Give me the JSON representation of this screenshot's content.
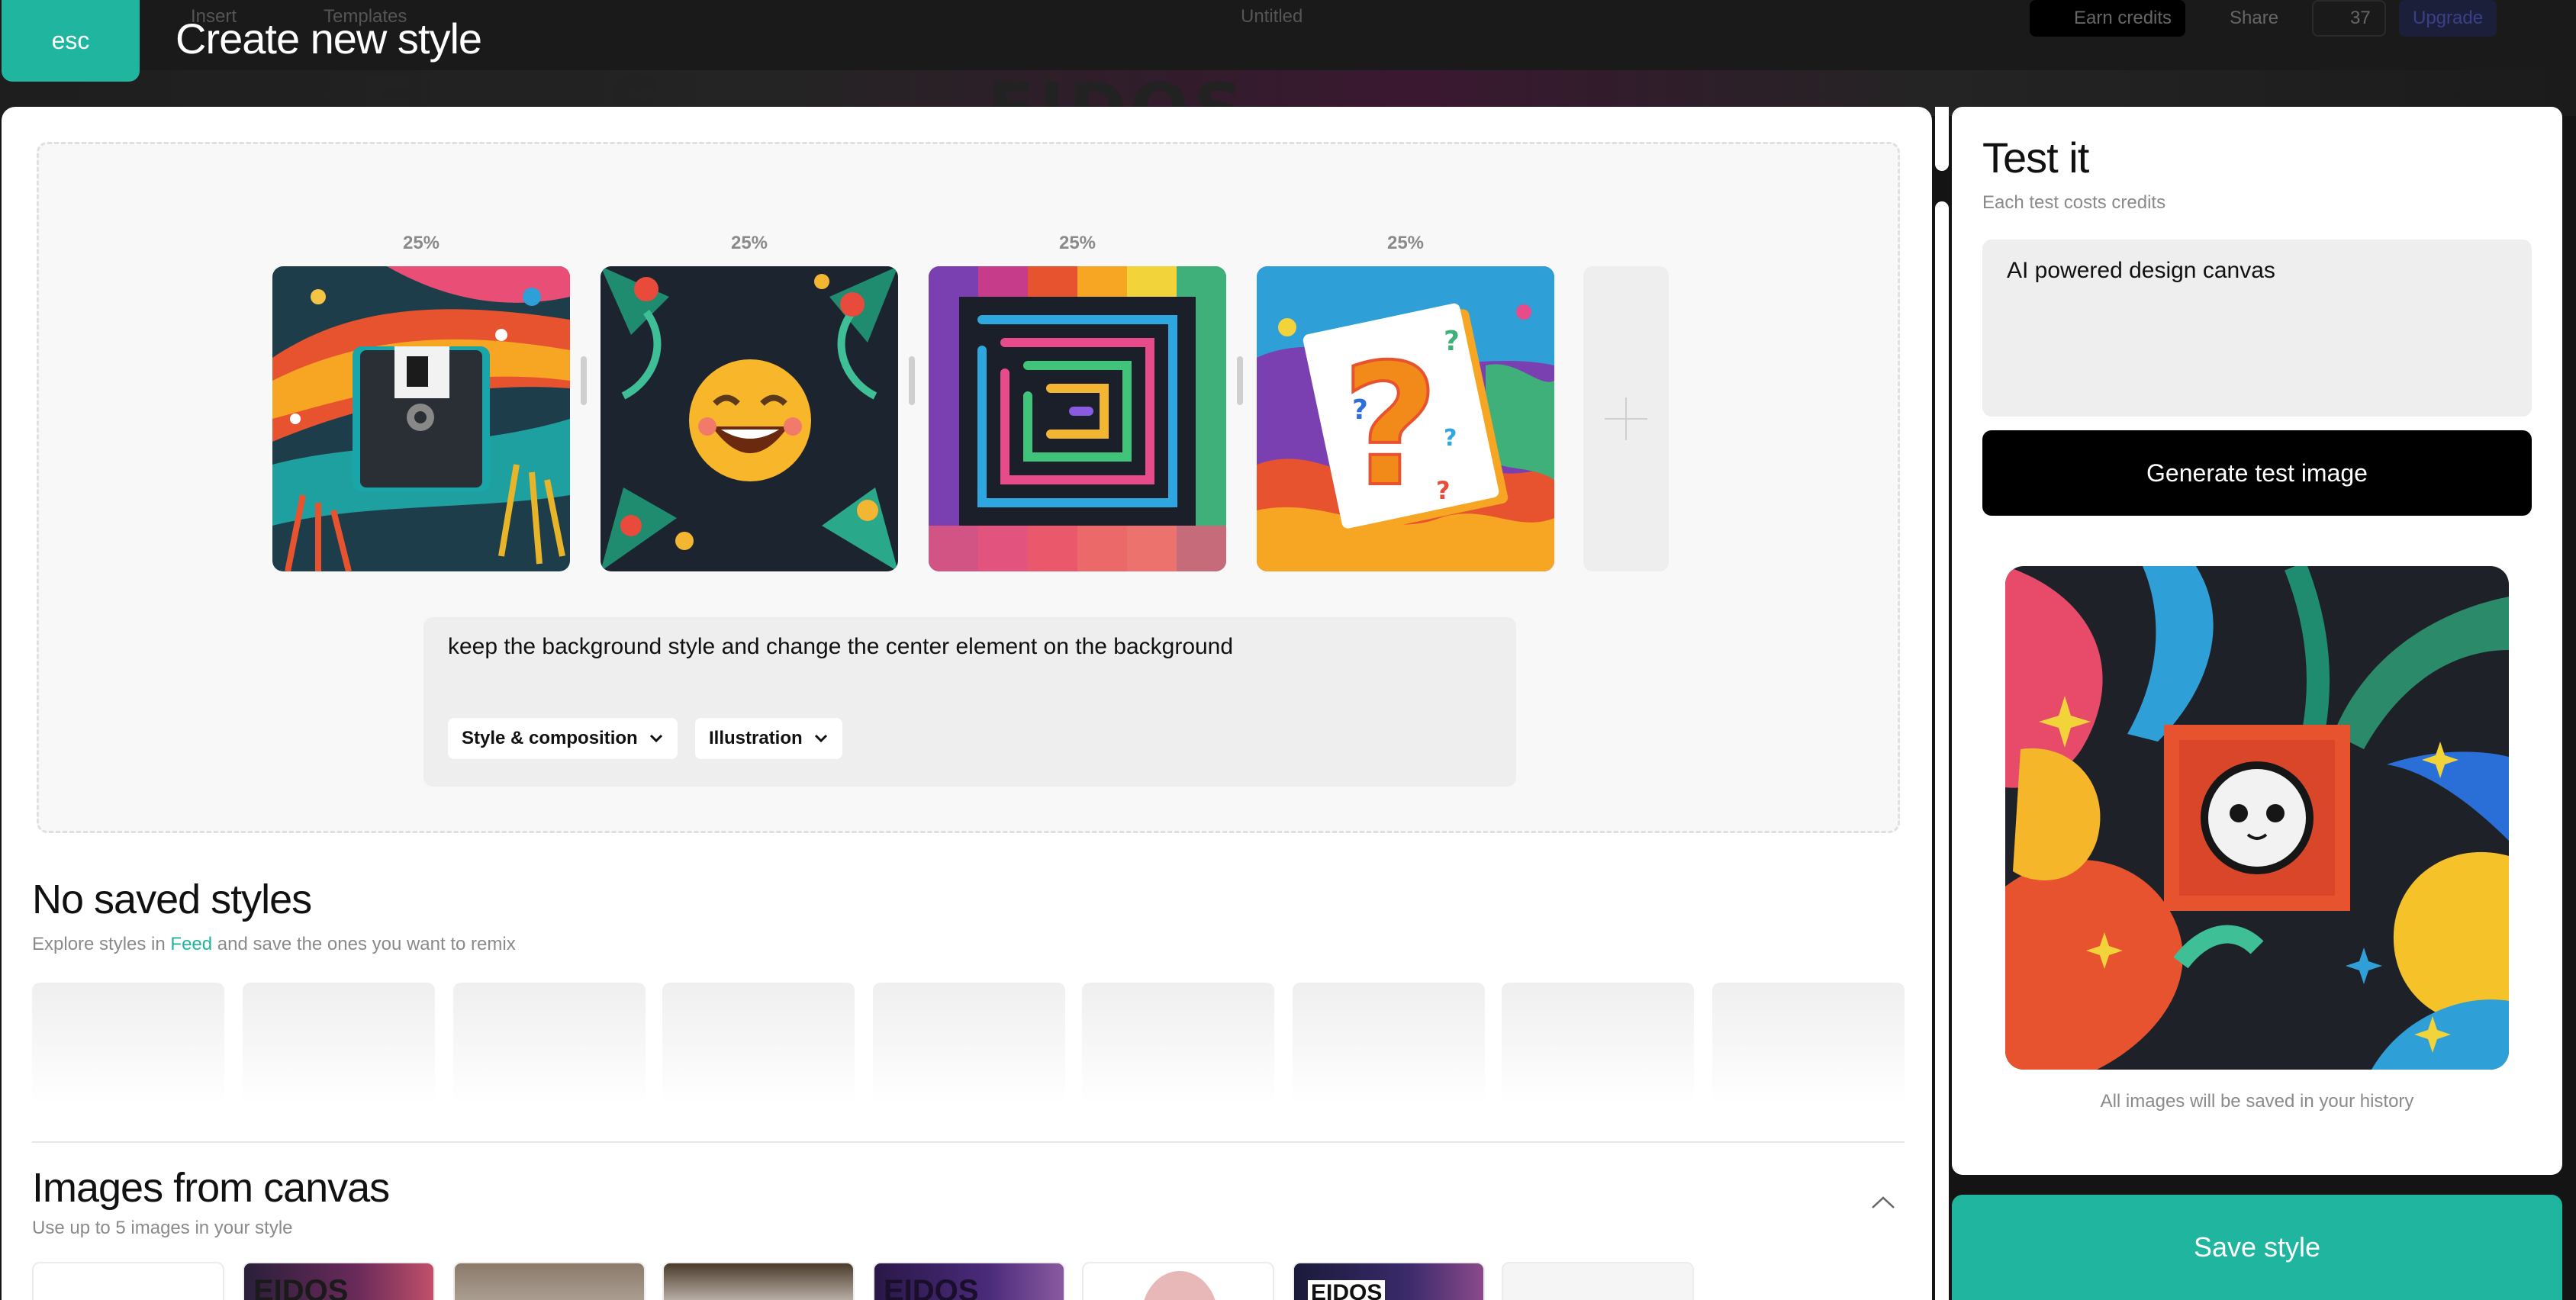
{
  "background_app": {
    "menu_items": [
      "Insert",
      "Templates"
    ],
    "doc_title": "Untitled",
    "earn_credits": "Earn credits",
    "share": "Share",
    "credits": "37",
    "upgrade": "Upgrade",
    "watermark_text": "EIDOS"
  },
  "modal": {
    "esc_label": "esc",
    "title": "Create new style"
  },
  "style_images": {
    "slots": [
      {
        "weight_label": "25%"
      },
      {
        "weight_label": "25%"
      },
      {
        "weight_label": "25%"
      },
      {
        "weight_label": "25%"
      }
    ],
    "prompt": "keep the background style and change the center element on the background",
    "dropdown_mode": "Style & composition",
    "dropdown_type": "Illustration"
  },
  "saved_styles": {
    "title": "No saved styles",
    "subtitle_before": "Explore styles in",
    "subtitle_link": "Feed",
    "subtitle_after": "and save the ones you want to remix"
  },
  "canvas_images": {
    "title": "Images from canvas",
    "subtitle": "Use up to 5 images in your style",
    "thumbnail_labels": [
      "EIDOS",
      "EIDOS",
      "EIDOS"
    ]
  },
  "test_panel": {
    "title": "Test it",
    "subtitle": "Each test costs credits",
    "input_value": "AI powered design canvas",
    "generate_label": "Generate test image",
    "history_note": "All images will be saved in your history"
  },
  "save_label": "Save style",
  "colors": {
    "accent": "#20b59f",
    "primary_button": "#000000",
    "panel_bg": "#ffffff",
    "field_bg": "#eeeeee"
  }
}
